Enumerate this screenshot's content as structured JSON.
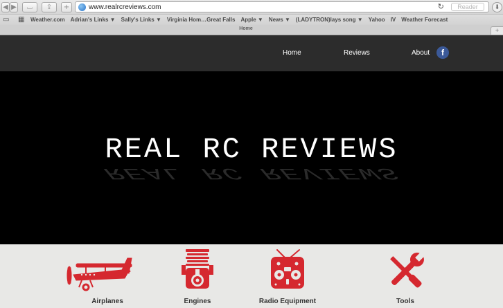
{
  "browser": {
    "url": "www.realrcreviews.com",
    "reader_label": "Reader",
    "tab_title": "Home",
    "bookmarks": [
      "Weather.com",
      "Adrian's Links ▼",
      "Sally's Links ▼",
      "Virginia Hom…Great Falls",
      "Apple ▼",
      "News ▼",
      "(LADYTRON)lays song ▼",
      "Yahoo",
      "IV",
      "Weather Forecast"
    ]
  },
  "nav": {
    "home": "Home",
    "reviews": "Reviews",
    "about": "About",
    "facebook": "f"
  },
  "hero": {
    "title": "REAL RC REVIEWS"
  },
  "categories": [
    {
      "label": "Airplanes",
      "icon": "airplane-icon"
    },
    {
      "label": "Engines",
      "icon": "engine-icon"
    },
    {
      "label": "Radio Equipment",
      "icon": "radio-transmitter-icon"
    },
    {
      "label": "Tools",
      "icon": "tools-icon"
    }
  ],
  "colors": {
    "accent": "#d5282f",
    "nav_bg": "#2c2c2c",
    "hero_bg": "#000000",
    "category_bg": "#e8e8e6"
  }
}
